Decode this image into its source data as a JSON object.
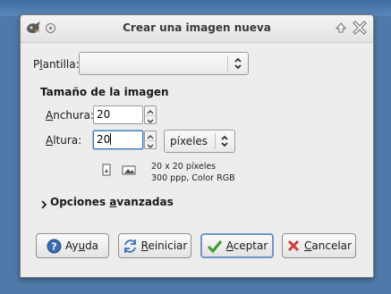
{
  "window": {
    "title": "Crear una imagen nueva"
  },
  "template": {
    "label_pre": "P",
    "label_acc": "l",
    "label_post": "antilla:",
    "value": ""
  },
  "image_size": {
    "title": "Tamaño de la imagen",
    "width_label_acc": "A",
    "width_label_post": "nchura:",
    "width_value": "20",
    "height_label_acc": "A",
    "height_label_post": "ltura:",
    "height_value": "20",
    "unit": "píxeles",
    "info_line1": "20 x 20 píxeles",
    "info_line2": "300 ppp, Color RGB"
  },
  "advanced": {
    "label_pre": "Opciones ",
    "label_acc": "a",
    "label_post": "vanzadas"
  },
  "buttons": {
    "help_pre": "Ay",
    "help_acc": "u",
    "help_post": "da",
    "reset_acc": "R",
    "reset_post": "einiciar",
    "ok_acc": "A",
    "ok_post": "ceptar",
    "cancel_acc": "C",
    "cancel_post": "ancelar"
  },
  "icons": {
    "app": "gimp-icon",
    "sticky": "circle-icon",
    "roll_up": "up-arrow-icon",
    "close": "close-icon",
    "portrait": "portrait-icon",
    "landscape": "landscape-icon",
    "help": "help-icon",
    "reset": "reset-icon",
    "ok": "check-icon",
    "cancel": "cancel-icon"
  },
  "colors": {
    "desktop": "#4f79a8",
    "focus": "#3f74b9",
    "ok_green": "#3f9a2f",
    "cancel_red": "#d33a3a"
  }
}
